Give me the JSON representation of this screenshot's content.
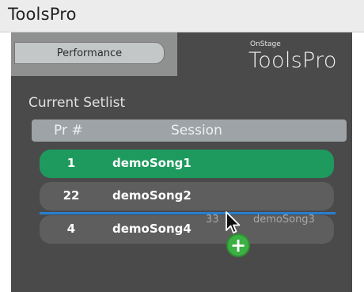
{
  "window": {
    "title": "ToolsPro"
  },
  "toolbar": {
    "performance_label": "Performance"
  },
  "brand": {
    "small": "OnStage",
    "large": "ToolsPro"
  },
  "setlist": {
    "label": "Current Setlist",
    "columns": {
      "pr": "Pr #",
      "session": "Session"
    },
    "rows": [
      {
        "pr": "1",
        "session": "demoSong1",
        "selected": true
      },
      {
        "pr": "22",
        "session": "demoSong2",
        "selected": false
      },
      {
        "pr": "4",
        "session": "demoSong4",
        "selected": false
      }
    ],
    "dragging": {
      "pr": "33",
      "session": "demoSong3"
    }
  },
  "colors": {
    "selected_row": "#1e9a5e",
    "row": "#5e5e5e",
    "drop_indicator": "#2a7fd1",
    "add_badge": "#3cb043"
  },
  "icons": {
    "cursor": "arrow-cursor-icon",
    "add": "plus-icon"
  }
}
